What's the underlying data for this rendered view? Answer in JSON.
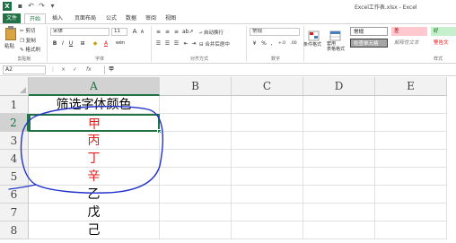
{
  "window": {
    "title": "Excel工作表.xlsx - Excel",
    "logo": "X",
    "qat": [
      "save-icon",
      "undo-icon",
      "redo-icon",
      "customize-icon"
    ]
  },
  "tabs": [
    "文件",
    "开始",
    "插入",
    "页面布局",
    "公式",
    "数据",
    "审阅",
    "视图"
  ],
  "active_tab": "开始",
  "ribbon": {
    "clipboard": {
      "label": "剪贴板",
      "paste": "粘贴",
      "cut": "剪切",
      "copy": "复制",
      "format_painter": "格式刷"
    },
    "font": {
      "label": "字体",
      "font_name": "宋体",
      "font_size": "11",
      "bold": "B",
      "italic": "I",
      "underline": "U",
      "grow": "A",
      "shrink": "A",
      "font_color": "A",
      "fill": "◆",
      "phonetic": "wén"
    },
    "alignment": {
      "label": "对齐方式",
      "wrap_text": "自动换行",
      "merge_center": "合并后居中"
    },
    "number": {
      "label": "数字",
      "format": "常规",
      "currency": "¥",
      "percent": "%",
      "comma": ",",
      "inc_decimal": "+.0",
      "dec_decimal": ".00"
    },
    "styles": {
      "label": "样式",
      "conditional": "条件格式",
      "format_table": "套用\n表格格式",
      "normal": "常规",
      "bad": "差",
      "good": "好",
      "check_cell": "检查单元格",
      "explanatory": "解释性文本",
      "warning": "警告文"
    }
  },
  "formula_bar": {
    "name_box": "A2",
    "cancel": "×",
    "enter": "✓",
    "fx": "fx",
    "content": "甲"
  },
  "sheet": {
    "columns": [
      "A",
      "B",
      "C",
      "D",
      "E"
    ],
    "selected_column": "A",
    "rows": [
      "1",
      "2",
      "3",
      "4",
      "5",
      "6",
      "7",
      "8"
    ],
    "selected_row": "2",
    "cells_a": [
      {
        "text": "筛选字体颜色",
        "color": "#000000"
      },
      {
        "text": "甲",
        "color": "#e02020"
      },
      {
        "text": "丙",
        "color": "#e02020"
      },
      {
        "text": "丁",
        "color": "#e02020"
      },
      {
        "text": "辛",
        "color": "#e02020"
      },
      {
        "text": "乙",
        "color": "#000000"
      },
      {
        "text": "戊",
        "color": "#000000"
      },
      {
        "text": "己",
        "color": "#000000"
      }
    ],
    "active_cell": "A2"
  },
  "colors": {
    "excel_green": "#217346",
    "annotation_blue": "#2233cc",
    "red_text": "#e02020"
  }
}
